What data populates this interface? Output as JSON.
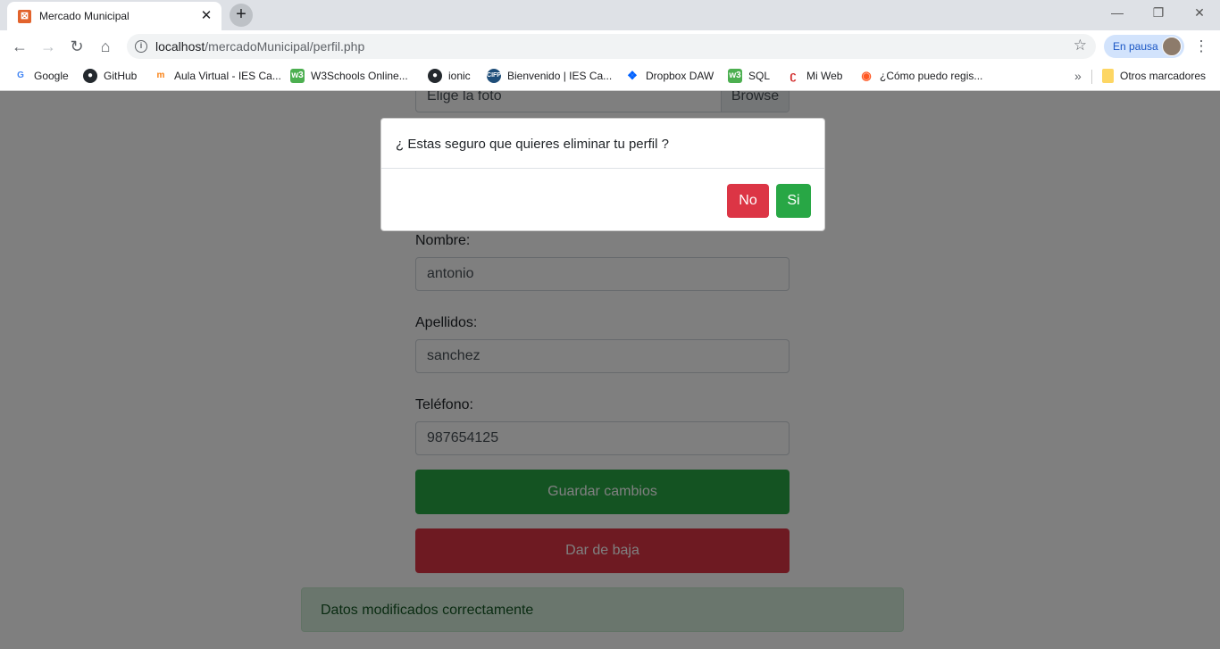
{
  "browser": {
    "tab_title": "Mercado Municipal",
    "tab_close": "✕",
    "new_tab": "+",
    "url_host": "localhost",
    "url_path": "/mercadoMunicipal/perfil.php",
    "profile_status": "En pausa",
    "bookmarks": [
      {
        "label": "Google",
        "icon": "google-icon",
        "color": "#4285f4"
      },
      {
        "label": "GitHub",
        "icon": "github-icon",
        "color": "#24292e"
      },
      {
        "label": "Aula Virtual - IES Ca...",
        "icon": "moodle-icon",
        "color": "#f98012"
      },
      {
        "label": "W3Schools Online...",
        "icon": "w3schools-icon",
        "color": "#4caf50"
      },
      {
        "label": "ionic",
        "icon": "github-icon",
        "color": "#24292e"
      },
      {
        "label": "Bienvenido | IES Ca...",
        "icon": "ies-icon",
        "color": "#1f4e79"
      },
      {
        "label": "Dropbox DAW",
        "icon": "dropbox-icon",
        "color": "#0061ff"
      },
      {
        "label": "SQL",
        "icon": "w3schools-icon",
        "color": "#4caf50"
      },
      {
        "label": "Mi Web",
        "icon": "web-icon",
        "color": "#d32f2f"
      },
      {
        "label": "¿Cómo puedo regis...",
        "icon": "question-icon",
        "color": "#ff5722"
      }
    ],
    "more_bookmarks": "»",
    "other_bookmarks": "Otros marcadores"
  },
  "form": {
    "file_placeholder": "Elige la foto",
    "file_button": "Browse",
    "name_label": "Nombre:",
    "name_value": "antonio",
    "surname_label": "Apellidos:",
    "surname_value": "sanchez",
    "phone_label": "Teléfono:",
    "phone_value": "987654125",
    "save_button": "Guardar cambios",
    "delete_button": "Dar de baja"
  },
  "alert": {
    "message": "Datos modificados correctamente"
  },
  "modal": {
    "question": "¿ Estas seguro que quieres eliminar tu perfil ?",
    "no_button": "No",
    "yes_button": "Si"
  }
}
